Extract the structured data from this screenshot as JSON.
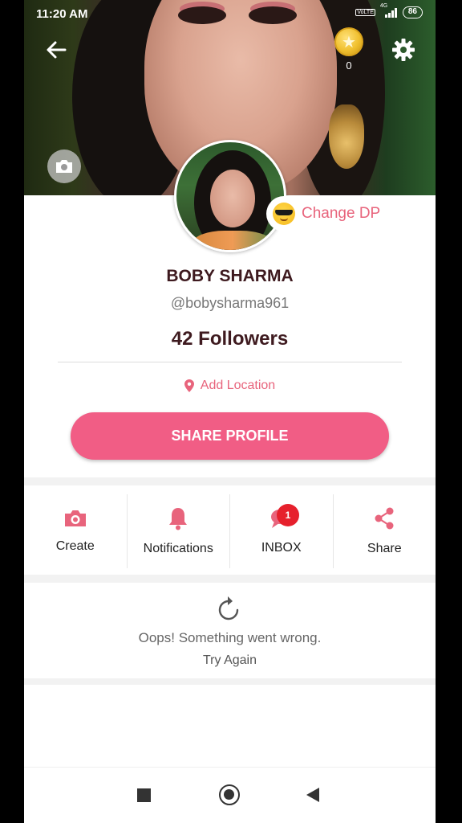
{
  "status_bar": {
    "time": "11:20 AM",
    "network_label": "4G",
    "volte_label": "VoLTE",
    "battery": "86"
  },
  "cover": {
    "coin_count": "0"
  },
  "profile": {
    "change_dp_label": "Change DP",
    "name": "BOBY SHARMA",
    "handle": "@bobysharma961",
    "followers": "42 Followers",
    "location_label": "Add Location",
    "share_label": "SHARE PROFILE"
  },
  "actions": [
    {
      "label": "Create",
      "icon": "camera-icon"
    },
    {
      "label": "Notifications",
      "icon": "bell-icon"
    },
    {
      "label": "INBOX",
      "icon": "chat-icon",
      "badge": "1"
    },
    {
      "label": "Share",
      "icon": "share-icon"
    }
  ],
  "error": {
    "message": "Oops! Something went wrong.",
    "retry_label": "Try Again"
  },
  "colors": {
    "accent": "#f15d85",
    "accent_text": "#e8647c",
    "badge": "#e6202c",
    "title": "#3e1a1f"
  }
}
